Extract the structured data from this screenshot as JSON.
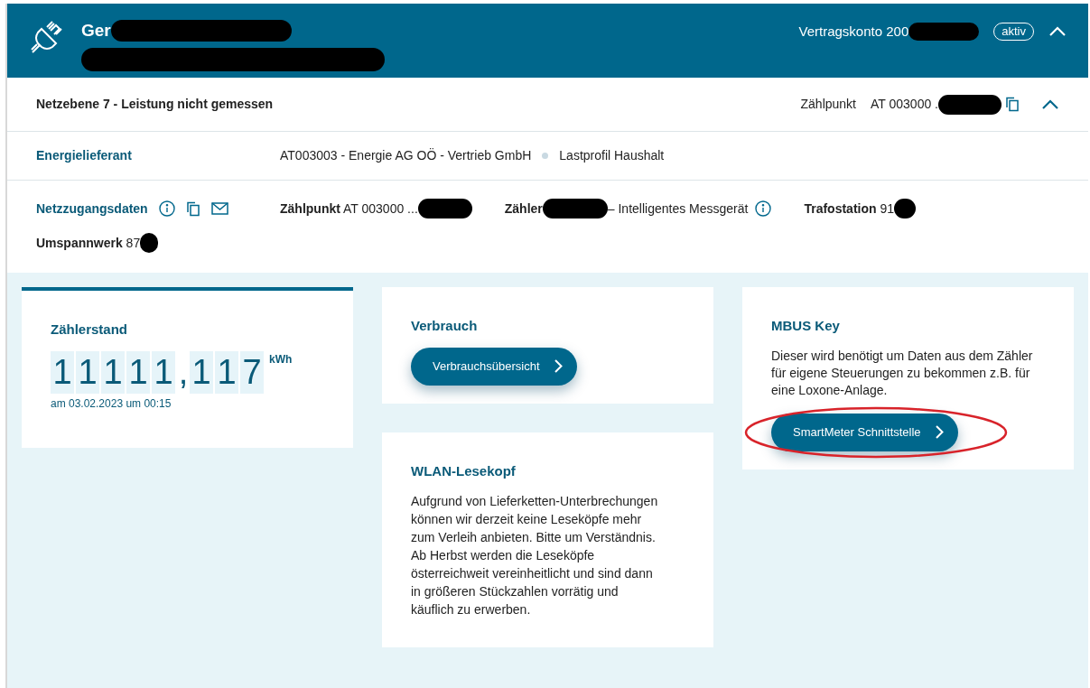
{
  "header": {
    "title": "Ger",
    "account": "Vertragskonto 200",
    "status_badge": "aktiv",
    "expanded": true
  },
  "subheader": {
    "title": "Netzebene 7 - Leistung nicht gemessen",
    "meter_point_label": "Zählpunkt",
    "meter_point_value": "AT 003000 .",
    "expanded": true
  },
  "supplier": {
    "label": "Energielieferant",
    "value": "AT003003 - Energie AG OÖ - Vertrieb GmbH",
    "profile": "Lastprofil Haushalt"
  },
  "grid_access": {
    "label": "Netzzugangsdaten",
    "items": [
      {
        "label": "Zählpunkt",
        "value": "AT 003000 ..."
      },
      {
        "label": "Zähler",
        "value": "– Intelligentes Messgerät",
        "info": true
      },
      {
        "label": "Trafostation",
        "value": "91"
      },
      {
        "label": "Umspannwerk",
        "value": "87"
      }
    ]
  },
  "cards": [
    {
      "kind": "meter",
      "title": "Zählerstand",
      "digits": [
        {
          "kind": "digit",
          "char": "1"
        },
        {
          "kind": "digit",
          "char": "1"
        },
        {
          "kind": "digit",
          "char": "1"
        },
        {
          "kind": "digit",
          "char": "1"
        },
        {
          "kind": "digit",
          "char": "1"
        },
        {
          "kind": "separator",
          "char": ","
        },
        {
          "kind": "digit",
          "char": "1"
        },
        {
          "kind": "digit",
          "char": "1"
        },
        {
          "kind": "digit",
          "char": "7"
        }
      ],
      "unit": "kWh",
      "timestamp": "am 03.02.2023 um 00:15"
    },
    {
      "kind": "action",
      "title": "Verbrauch",
      "button": "Verbrauchsübersicht"
    },
    {
      "kind": "action",
      "title": "MBUS Key",
      "text": "Dieser wird benötigt um Daten aus dem Zähler für eigene Steuerungen zu bekommen z.B. für eine Loxone-Anlage.",
      "button": "SmartMeter Schnittstelle",
      "highlighted": true
    },
    {
      "kind": "text",
      "title": "WLAN-Lesekopf",
      "text": "Aufgrund von Lieferketten-Unterbrechungen können wir derzeit keine Leseköpfe mehr zum Verleih anbieten. Bitte um Verständnis. Ab Herbst werden die Leseköpfe österreichweit vereinheitlicht und sind dann in größeren Stückzahlen vorrätig und käuflich zu erwerben."
    }
  ]
}
